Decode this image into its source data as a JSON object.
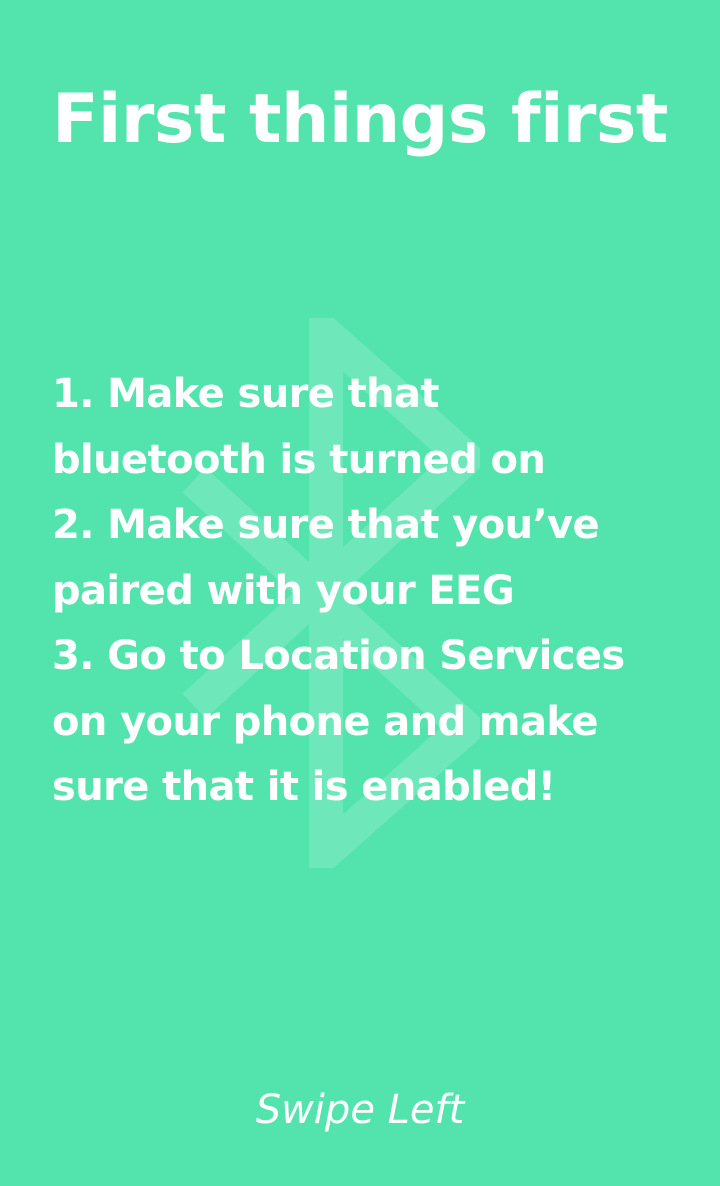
{
  "screen": {
    "title": "First things first",
    "background_color": "#53e3ad",
    "text_color": "#ffffff",
    "watermark_icon": "bluetooth-icon",
    "steps": [
      "1. Make sure that\nbluetooth is turned on",
      "2. Make sure that you’ve\npaired with your EEG",
      "3. Go to Location Services\non your phone and make\nsure that it is enabled!"
    ],
    "swipe_hint": "Swipe Left"
  }
}
